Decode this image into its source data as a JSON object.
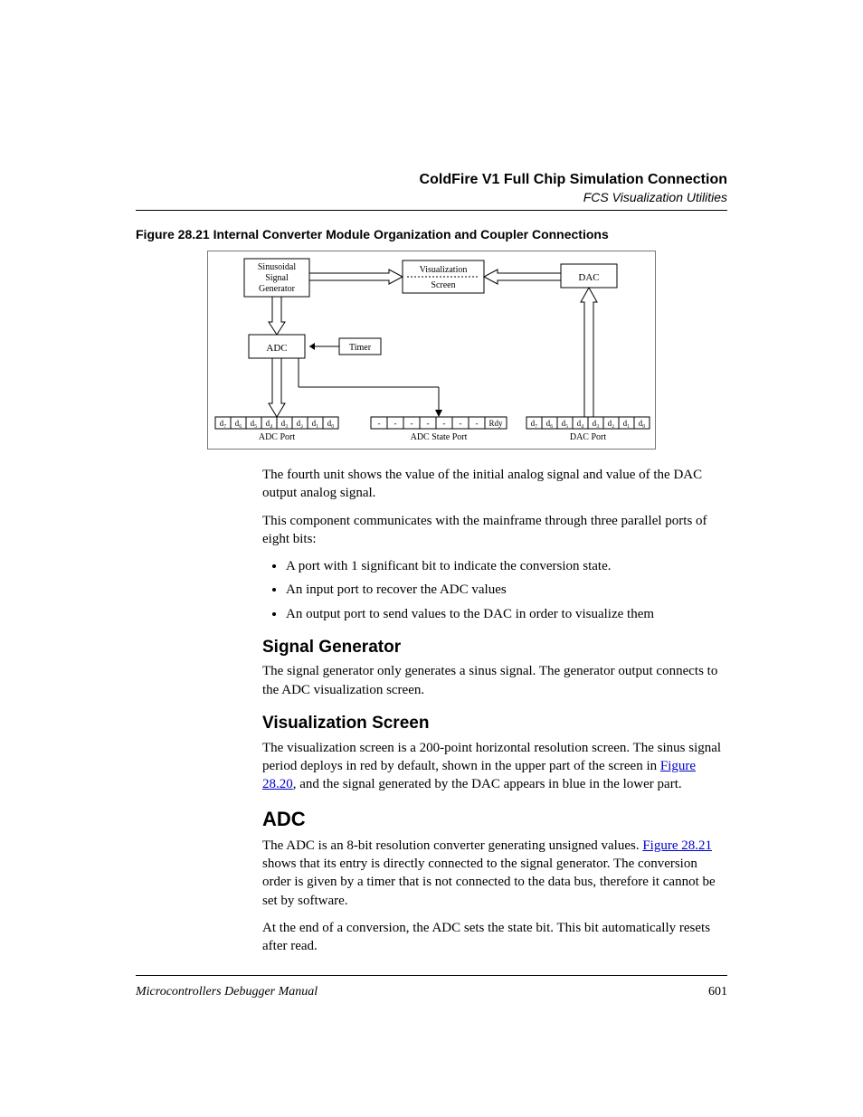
{
  "header": {
    "title": "ColdFire V1 Full Chip Simulation Connection",
    "subtitle": "FCS Visualization Utilities"
  },
  "figure": {
    "caption": "Figure 28.21  Internal Converter Module Organization and Coupler Connections",
    "boxes": {
      "sig_gen_l1": "Sinusoidal",
      "sig_gen_l2": "Signal",
      "sig_gen_l3": "Generator",
      "viz_l1": "Visualization",
      "viz_l2": "Screen",
      "dac": "DAC",
      "adc": "ADC",
      "timer": "Timer"
    },
    "adc_port": {
      "cells": [
        "d₇",
        "d₆",
        "d₅",
        "d₄",
        "d₃",
        "d₂",
        "d₁",
        "d₀"
      ],
      "label": "ADC Port"
    },
    "state_port": {
      "cells": [
        "-",
        "-",
        "-",
        "-",
        "-",
        "-",
        "-",
        "Rdy"
      ],
      "label": "ADC State Port"
    },
    "dac_port": {
      "cells": [
        "d₇",
        "d₆",
        "d₅",
        "d₄",
        "d₃",
        "d₂",
        "d₁",
        "d₀"
      ],
      "label": "DAC Port"
    }
  },
  "para1": "The fourth unit shows the value of the initial analog signal and value of the DAC output analog signal.",
  "para2": "This component communicates with the mainframe through three parallel ports of eight bits:",
  "bullets": [
    "A port with 1 significant bit to indicate the conversion state.",
    "An input port to recover the ADC values",
    "An output port to send values to the DAC in order to visualize them"
  ],
  "sections": {
    "sig_gen": {
      "title": "Signal Generator",
      "body": "The signal generator only generates a sinus signal. The generator output connects to the ADC visualization screen."
    },
    "viz": {
      "title": "Visualization Screen",
      "body_a": "The visualization screen is a 200-point horizontal resolution screen. The sinus signal period deploys in red by default, shown in the upper part of the screen in ",
      "link": "Figure 28.20",
      "body_b": ", and the signal generated by the DAC appears in blue in the lower part."
    },
    "adc": {
      "title": "ADC",
      "body_a": "The ADC is an 8-bit resolution converter generating unsigned values. ",
      "link": "Figure 28.21",
      "body_b": " shows that its entry is directly connected to the signal generator. The conversion order is given by a timer that is not connected to the data bus, therefore it cannot be set by software.",
      "body2": "At the end of a conversion, the ADC sets the state bit. This bit automatically resets after read."
    }
  },
  "footer": {
    "left": "Microcontrollers Debugger Manual",
    "right": "601"
  }
}
